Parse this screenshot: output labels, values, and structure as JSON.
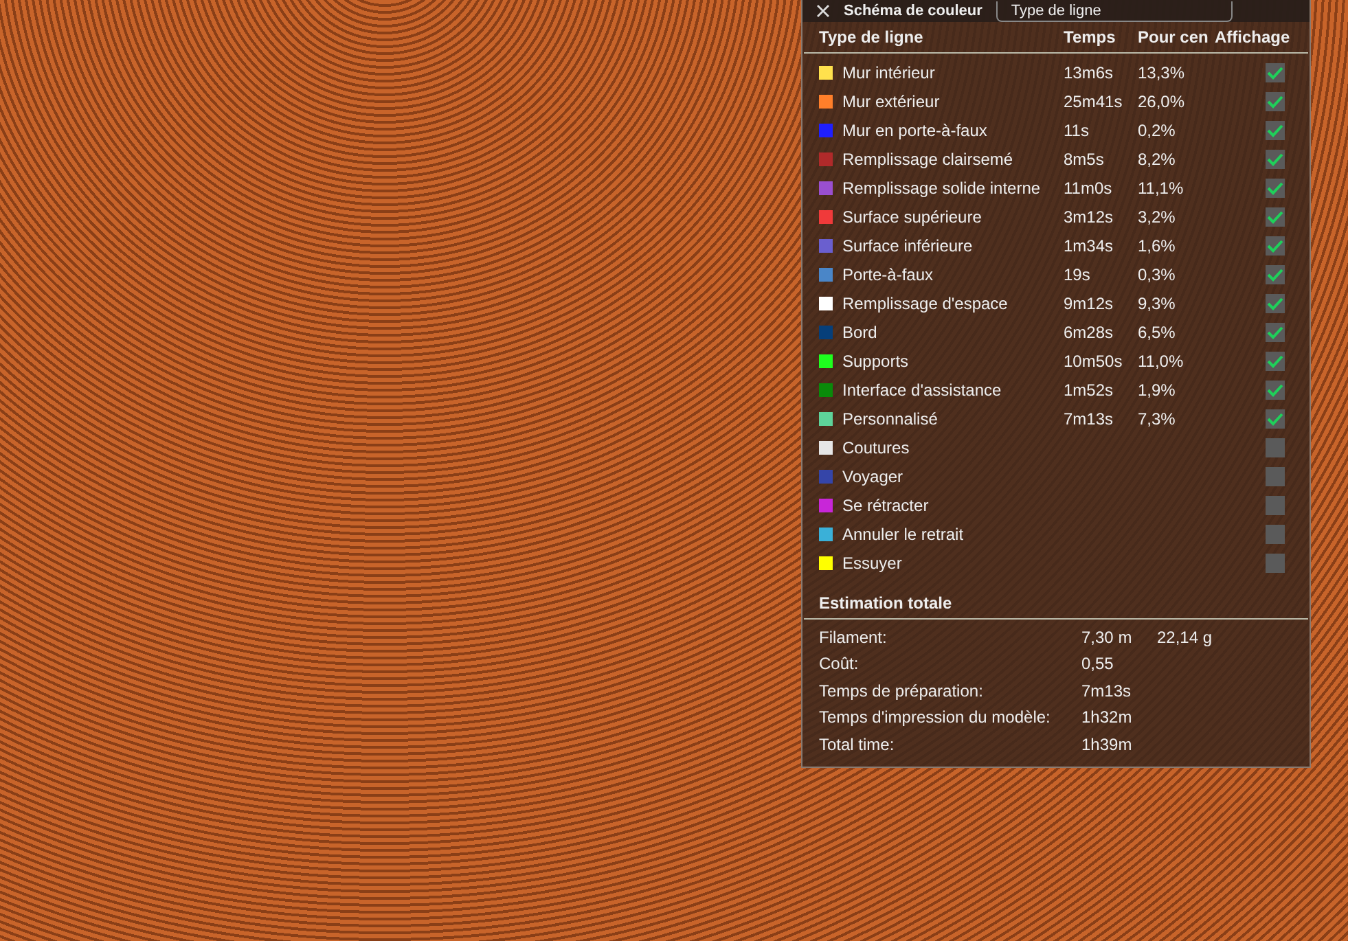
{
  "legend": {
    "title": "Schéma de couleur",
    "view_type": "Type de ligne",
    "columns": [
      "Type de ligne",
      "Temps",
      "Pour cen",
      "Affichage"
    ],
    "rows": [
      {
        "name": "Mur intérieur",
        "color": "#ffe14d",
        "time": "13m6s",
        "percent": "13,3%",
        "checked": true
      },
      {
        "name": "Mur extérieur",
        "color": "#ff7f2a",
        "time": "25m41s",
        "percent": "26,0%",
        "checked": true
      },
      {
        "name": "Mur en porte-à-faux",
        "color": "#1f1fff",
        "time": "11s",
        "percent": "0,2%",
        "checked": true
      },
      {
        "name": "Remplissage clairsemé",
        "color": "#b02a2a",
        "time": "8m5s",
        "percent": "8,2%",
        "checked": true
      },
      {
        "name": "Remplissage solide interne",
        "color": "#9a4fd0",
        "time": "11m0s",
        "percent": "11,1%",
        "checked": true
      },
      {
        "name": "Surface supérieure",
        "color": "#f03a3a",
        "time": "3m12s",
        "percent": "3,2%",
        "checked": true
      },
      {
        "name": "Surface inférieure",
        "color": "#6a5fcf",
        "time": "1m34s",
        "percent": "1,6%",
        "checked": true
      },
      {
        "name": "Porte-à-faux",
        "color": "#4a86c8",
        "time": "19s",
        "percent": "0,3%",
        "checked": true
      },
      {
        "name": "Remplissage d'espace",
        "color": "#ffffff",
        "time": "9m12s",
        "percent": "9,3%",
        "checked": true
      },
      {
        "name": "Bord",
        "color": "#063f7a",
        "time": "6m28s",
        "percent": "6,5%",
        "checked": true
      },
      {
        "name": "Supports",
        "color": "#1eff1e",
        "time": "10m50s",
        "percent": "11,0%",
        "checked": true
      },
      {
        "name": "Interface d'assistance",
        "color": "#0a8a0a",
        "time": "1m52s",
        "percent": "1,9%",
        "checked": true
      },
      {
        "name": "Personnalisé",
        "color": "#5ed39a",
        "time": "7m13s",
        "percent": "7,3%",
        "checked": true
      },
      {
        "name": "Coutures",
        "color": "#e6e6e6",
        "checked": false
      },
      {
        "name": "Voyager",
        "color": "#3545a8",
        "checked": false
      },
      {
        "name": "Se rétracter",
        "color": "#c826d8",
        "checked": false
      },
      {
        "name": "Annuler le retrait",
        "color": "#3ab0d8",
        "checked": false
      },
      {
        "name": "Essuyer",
        "color": "#ffff00",
        "checked": false
      }
    ]
  },
  "summary": {
    "title": "Estimation totale",
    "rows": [
      {
        "label": "Filament:",
        "value": "7,30 m",
        "extra": "22,14 g"
      },
      {
        "label": "Coût:",
        "value": "0,55"
      },
      {
        "label": "Temps de préparation:",
        "value": "7m13s"
      },
      {
        "label": "Temps d'impression du modèle:",
        "value": "1h32m"
      },
      {
        "label": "Total time:",
        "value": "1h39m"
      }
    ]
  }
}
